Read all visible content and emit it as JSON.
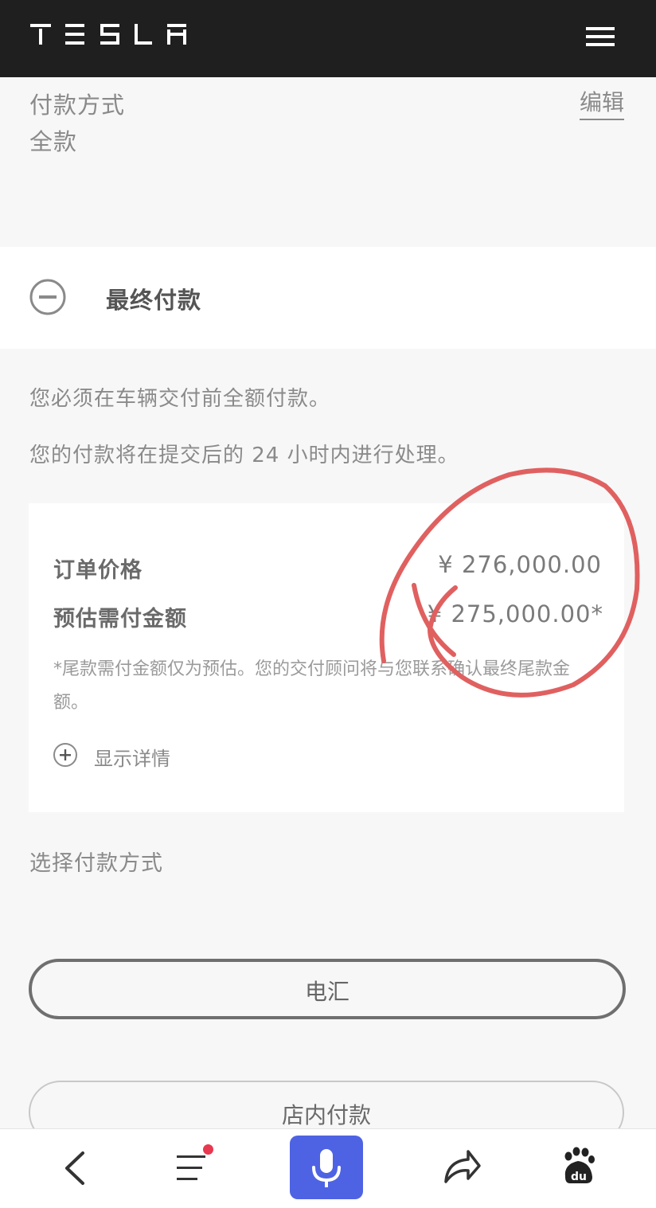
{
  "header": {
    "brand": "TESLA",
    "menu_icon": "hamburger-icon"
  },
  "payment_method": {
    "label": "付款方式",
    "value": "全款",
    "edit_label": "编辑"
  },
  "final_payment": {
    "title": "最终付款",
    "collapse_icon": "minus-circle-icon",
    "info_1": "您必须在车辆交付前全额付款。",
    "info_2": "您的付款将在提交后的 24 小时内进行处理。"
  },
  "price_card": {
    "order_price_label": "订单价格",
    "order_price_value": "¥ 276,000.00",
    "estimated_label": "预估需付金额",
    "estimated_value": "¥ 275,000.00*",
    "note": "*尾款需付金额仅为预估。您的交付顾问将与您联系确认最终尾款金额。",
    "details_label": "显示详情",
    "details_icon": "plus-circle-icon"
  },
  "select_method": {
    "label": "选择付款方式",
    "options": [
      "电汇",
      "店内付款"
    ]
  },
  "bottom_nav": {
    "icons": [
      "back-icon",
      "menu-icon",
      "microphone-icon",
      "share-icon",
      "baidu-paw-icon"
    ],
    "baidu_text": "du"
  },
  "colors": {
    "header_bg": "#1f1f1f",
    "mic_blue": "#4e63e3",
    "annotation_red": "#e06060",
    "badge_red": "#e8384f"
  }
}
